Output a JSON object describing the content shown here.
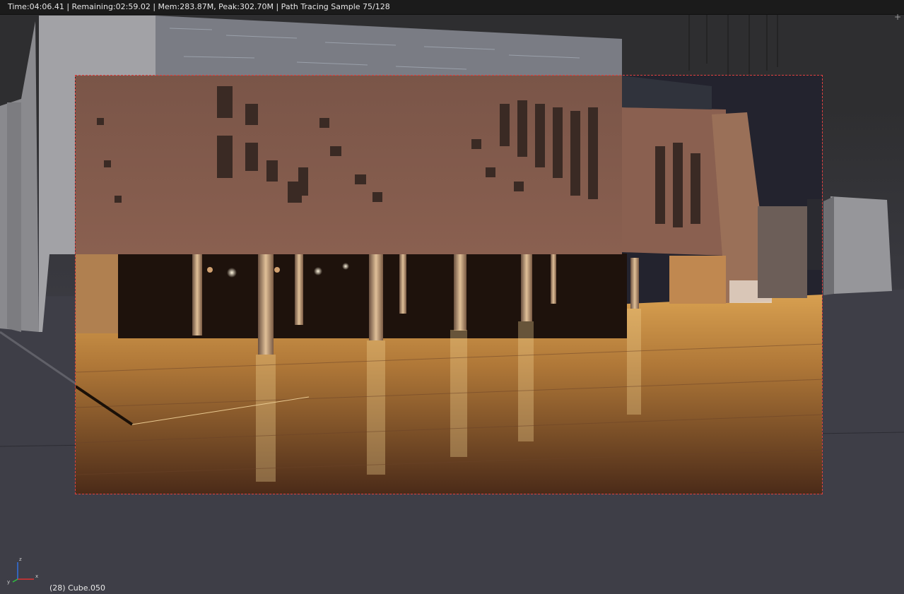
{
  "header": {
    "status": "Time:04:06.41 | Remaining:02:59.02 | Mem:283.87M, Peak:302.70M | Path Tracing Sample 75/128"
  },
  "viewport": {
    "object_info": "(28) Cube.050",
    "corner_widget": "+"
  },
  "axis_gizmo": {
    "z_label": "z",
    "y_label": "y",
    "x_label": "x",
    "x_color": "#e03030",
    "y_color": "#30c040",
    "z_color": "#3070e0"
  },
  "colors": {
    "render_border": "#e04040",
    "header_bg": "#1b1b1b",
    "viewport_bg": "#3c3c44"
  }
}
